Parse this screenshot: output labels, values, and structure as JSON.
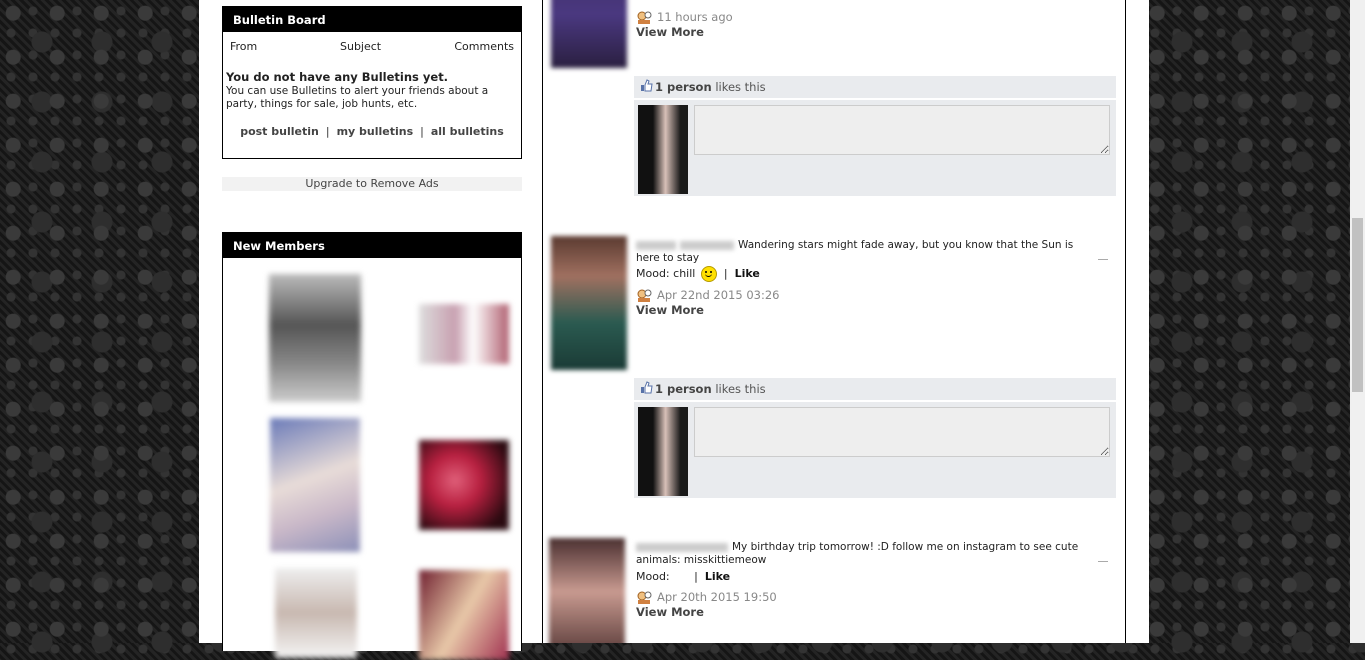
{
  "bulletin": {
    "title": "Bulletin Board",
    "col_from": "From",
    "col_subject": "Subject",
    "col_comments": "Comments",
    "empty_title": "You do not have any Bulletins yet.",
    "empty_desc": "You can use Bulletins to alert your friends about a party, things for sale, job hunts, etc.",
    "link_post": "post bulletin",
    "link_my": "my bulletins",
    "link_all": "all bulletins",
    "sep": "|"
  },
  "upgrade_label": "Upgrade to Remove Ads",
  "new_members": {
    "title": "New Members"
  },
  "feed": {
    "post1": {
      "time": "11 hours ago",
      "view_more": "View More"
    },
    "likes1": {
      "count": "1 person",
      "suffix": "likes this"
    },
    "post2": {
      "status": "Wandering stars might fade away, but you know that the Sun is here to stay",
      "mood_label": "Mood:",
      "mood_value": "chill",
      "sep": "|",
      "like_label": "Like",
      "time": "Apr 22nd 2015 03:26",
      "view_more": "View More"
    },
    "likes2": {
      "count": "1 person",
      "suffix": "likes this"
    },
    "post3": {
      "status": "My birthday trip tomorrow! :D follow me on instagram to see cute animals: misskittiemeow",
      "mood_label": "Mood:",
      "sep": "|",
      "like_label": "Like",
      "time": "Apr 20th 2015 19:50",
      "view_more": "View More"
    }
  },
  "colors": {
    "header_bg": "#000000",
    "likes_bg": "#e9ebee",
    "page_bg": "#1b1b1b"
  },
  "icons": [
    "thumbs-up-icon",
    "clock-person-icon",
    "smiley-icon",
    "resize-handle-icon"
  ]
}
